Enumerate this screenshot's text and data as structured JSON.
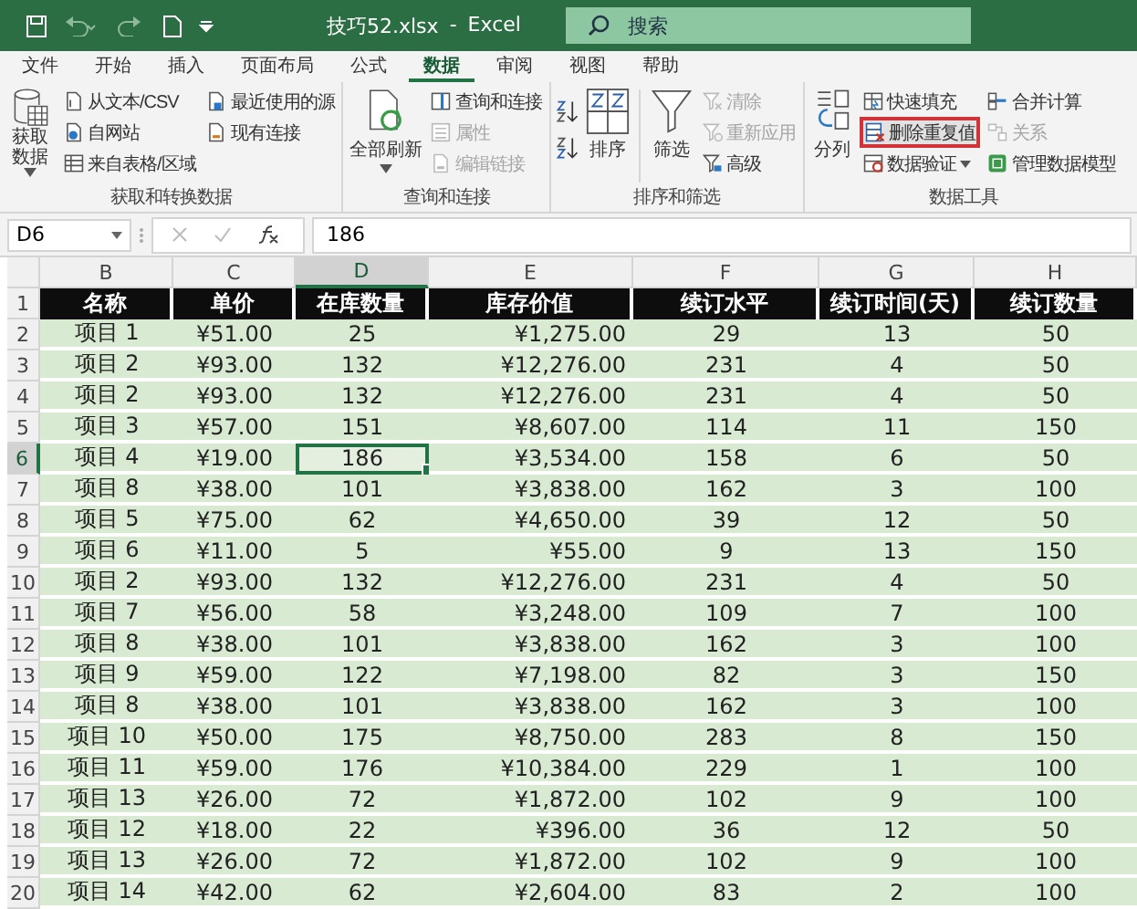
{
  "title_bar": {
    "filename": "技巧52.xlsx",
    "separator": "-",
    "app": "Excel",
    "search_placeholder": "搜索"
  },
  "menu_tabs": [
    {
      "label": "文件",
      "selected": false
    },
    {
      "label": "开始",
      "selected": false
    },
    {
      "label": "插入",
      "selected": false
    },
    {
      "label": "页面布局",
      "selected": false
    },
    {
      "label": "公式",
      "selected": false
    },
    {
      "label": "数据",
      "selected": true
    },
    {
      "label": "审阅",
      "selected": false
    },
    {
      "label": "视图",
      "selected": false
    },
    {
      "label": "帮助",
      "selected": false
    }
  ],
  "ribbon": {
    "groups": [
      {
        "label": "获取和转换数据",
        "controls": [
          {
            "kind": "large",
            "label": "获取数据",
            "dropdown": true,
            "disabled": false,
            "highlighted": false
          },
          {
            "kind": "small",
            "label": "从文本/CSV",
            "dropdown": false,
            "disabled": false,
            "highlighted": false
          },
          {
            "kind": "small",
            "label": "自网站",
            "dropdown": false,
            "disabled": false,
            "highlighted": false
          },
          {
            "kind": "small",
            "label": "来自表格/区域",
            "dropdown": false,
            "disabled": false,
            "highlighted": false
          },
          {
            "kind": "small",
            "label": "最近使用的源",
            "dropdown": false,
            "disabled": false,
            "highlighted": false
          },
          {
            "kind": "small",
            "label": "现有连接",
            "dropdown": false,
            "disabled": false,
            "highlighted": false
          }
        ]
      },
      {
        "label": "查询和连接",
        "controls": [
          {
            "kind": "large",
            "label": "全部刷新",
            "dropdown": true,
            "disabled": false,
            "highlighted": false
          },
          {
            "kind": "small",
            "label": "查询和连接",
            "dropdown": false,
            "disabled": false,
            "highlighted": false
          },
          {
            "kind": "small",
            "label": "属性",
            "dropdown": false,
            "disabled": true,
            "highlighted": false
          },
          {
            "kind": "small",
            "label": "编辑链接",
            "dropdown": false,
            "disabled": true,
            "highlighted": false
          }
        ]
      },
      {
        "label": "排序和筛选",
        "controls": [
          {
            "kind": "sort_pair"
          },
          {
            "kind": "large",
            "label": "排序",
            "dropdown": false,
            "disabled": false,
            "highlighted": false
          },
          {
            "kind": "large",
            "label": "筛选",
            "dropdown": false,
            "disabled": false,
            "highlighted": false
          },
          {
            "kind": "small",
            "label": "清除",
            "dropdown": false,
            "disabled": true,
            "highlighted": false
          },
          {
            "kind": "small",
            "label": "重新应用",
            "dropdown": false,
            "disabled": true,
            "highlighted": false
          },
          {
            "kind": "small",
            "label": "高级",
            "dropdown": false,
            "disabled": false,
            "highlighted": false
          }
        ]
      },
      {
        "label": "数据工具",
        "controls": [
          {
            "kind": "large",
            "label": "分列",
            "dropdown": false,
            "disabled": false,
            "highlighted": false
          },
          {
            "kind": "small",
            "label": "快速填充",
            "dropdown": false,
            "disabled": false,
            "highlighted": false
          },
          {
            "kind": "small",
            "label": "删除重复值",
            "dropdown": false,
            "disabled": false,
            "highlighted": true
          },
          {
            "kind": "small",
            "label": "数据验证",
            "dropdown": true,
            "disabled": false,
            "highlighted": false
          },
          {
            "kind": "small",
            "label": "合并计算",
            "dropdown": false,
            "disabled": false,
            "highlighted": false
          },
          {
            "kind": "small",
            "label": "关系",
            "dropdown": false,
            "disabled": true,
            "highlighted": false
          },
          {
            "kind": "small",
            "label": "管理数据模型",
            "dropdown": false,
            "disabled": false,
            "highlighted": false
          }
        ]
      }
    ]
  },
  "formula_bar": {
    "name_box": "D6",
    "formula": "186"
  },
  "sheet": {
    "columns": [
      {
        "label": "B",
        "selected": false
      },
      {
        "label": "C",
        "selected": false
      },
      {
        "label": "D",
        "selected": true
      },
      {
        "label": "E",
        "selected": false
      },
      {
        "label": "F",
        "selected": false
      },
      {
        "label": "G",
        "selected": false
      },
      {
        "label": "H",
        "selected": false
      }
    ],
    "rows": [
      {
        "number": "1",
        "kind": "header",
        "selected": false,
        "cells": [
          {
            "text": "名称",
            "active": false
          },
          {
            "text": "单价",
            "active": false
          },
          {
            "text": "在库数量",
            "active": false
          },
          {
            "text": "库存价值",
            "active": false
          },
          {
            "text": "续订水平",
            "active": false
          },
          {
            "text": "续订时间(天)",
            "active": false
          },
          {
            "text": "续订数量",
            "active": false
          }
        ]
      },
      {
        "number": "2",
        "kind": "data",
        "selected": false,
        "cells": [
          {
            "text": "项目 1",
            "active": false
          },
          {
            "text": "¥51.00",
            "active": false
          },
          {
            "text": "25",
            "active": false
          },
          {
            "text": "¥1,275.00",
            "active": false
          },
          {
            "text": "29",
            "active": false
          },
          {
            "text": "13",
            "active": false
          },
          {
            "text": "50",
            "active": false
          }
        ]
      },
      {
        "number": "3",
        "kind": "data",
        "selected": false,
        "cells": [
          {
            "text": "项目 2",
            "active": false
          },
          {
            "text": "¥93.00",
            "active": false
          },
          {
            "text": "132",
            "active": false
          },
          {
            "text": "¥12,276.00",
            "active": false
          },
          {
            "text": "231",
            "active": false
          },
          {
            "text": "4",
            "active": false
          },
          {
            "text": "50",
            "active": false
          }
        ]
      },
      {
        "number": "4",
        "kind": "data",
        "selected": false,
        "cells": [
          {
            "text": "项目 2",
            "active": false
          },
          {
            "text": "¥93.00",
            "active": false
          },
          {
            "text": "132",
            "active": false
          },
          {
            "text": "¥12,276.00",
            "active": false
          },
          {
            "text": "231",
            "active": false
          },
          {
            "text": "4",
            "active": false
          },
          {
            "text": "50",
            "active": false
          }
        ]
      },
      {
        "number": "5",
        "kind": "data",
        "selected": false,
        "cells": [
          {
            "text": "项目 3",
            "active": false
          },
          {
            "text": "¥57.00",
            "active": false
          },
          {
            "text": "151",
            "active": false
          },
          {
            "text": "¥8,607.00",
            "active": false
          },
          {
            "text": "114",
            "active": false
          },
          {
            "text": "11",
            "active": false
          },
          {
            "text": "150",
            "active": false
          }
        ]
      },
      {
        "number": "6",
        "kind": "data",
        "selected": true,
        "cells": [
          {
            "text": "项目 4",
            "active": false
          },
          {
            "text": "¥19.00",
            "active": false
          },
          {
            "text": "186",
            "active": true
          },
          {
            "text": "¥3,534.00",
            "active": false
          },
          {
            "text": "158",
            "active": false
          },
          {
            "text": "6",
            "active": false
          },
          {
            "text": "50",
            "active": false
          }
        ]
      },
      {
        "number": "7",
        "kind": "data",
        "selected": false,
        "cells": [
          {
            "text": "项目 8",
            "active": false
          },
          {
            "text": "¥38.00",
            "active": false
          },
          {
            "text": "101",
            "active": false
          },
          {
            "text": "¥3,838.00",
            "active": false
          },
          {
            "text": "162",
            "active": false
          },
          {
            "text": "3",
            "active": false
          },
          {
            "text": "100",
            "active": false
          }
        ]
      },
      {
        "number": "8",
        "kind": "data",
        "selected": false,
        "cells": [
          {
            "text": "项目 5",
            "active": false
          },
          {
            "text": "¥75.00",
            "active": false
          },
          {
            "text": "62",
            "active": false
          },
          {
            "text": "¥4,650.00",
            "active": false
          },
          {
            "text": "39",
            "active": false
          },
          {
            "text": "12",
            "active": false
          },
          {
            "text": "50",
            "active": false
          }
        ]
      },
      {
        "number": "9",
        "kind": "data",
        "selected": false,
        "cells": [
          {
            "text": "项目 6",
            "active": false
          },
          {
            "text": "¥11.00",
            "active": false
          },
          {
            "text": "5",
            "active": false
          },
          {
            "text": "¥55.00",
            "active": false
          },
          {
            "text": "9",
            "active": false
          },
          {
            "text": "13",
            "active": false
          },
          {
            "text": "150",
            "active": false
          }
        ]
      },
      {
        "number": "10",
        "kind": "data",
        "selected": false,
        "cells": [
          {
            "text": "项目 2",
            "active": false
          },
          {
            "text": "¥93.00",
            "active": false
          },
          {
            "text": "132",
            "active": false
          },
          {
            "text": "¥12,276.00",
            "active": false
          },
          {
            "text": "231",
            "active": false
          },
          {
            "text": "4",
            "active": false
          },
          {
            "text": "50",
            "active": false
          }
        ]
      },
      {
        "number": "11",
        "kind": "data",
        "selected": false,
        "cells": [
          {
            "text": "项目 7",
            "active": false
          },
          {
            "text": "¥56.00",
            "active": false
          },
          {
            "text": "58",
            "active": false
          },
          {
            "text": "¥3,248.00",
            "active": false
          },
          {
            "text": "109",
            "active": false
          },
          {
            "text": "7",
            "active": false
          },
          {
            "text": "100",
            "active": false
          }
        ]
      },
      {
        "number": "12",
        "kind": "data",
        "selected": false,
        "cells": [
          {
            "text": "项目 8",
            "active": false
          },
          {
            "text": "¥38.00",
            "active": false
          },
          {
            "text": "101",
            "active": false
          },
          {
            "text": "¥3,838.00",
            "active": false
          },
          {
            "text": "162",
            "active": false
          },
          {
            "text": "3",
            "active": false
          },
          {
            "text": "100",
            "active": false
          }
        ]
      },
      {
        "number": "13",
        "kind": "data",
        "selected": false,
        "cells": [
          {
            "text": "项目 9",
            "active": false
          },
          {
            "text": "¥59.00",
            "active": false
          },
          {
            "text": "122",
            "active": false
          },
          {
            "text": "¥7,198.00",
            "active": false
          },
          {
            "text": "82",
            "active": false
          },
          {
            "text": "3",
            "active": false
          },
          {
            "text": "150",
            "active": false
          }
        ]
      },
      {
        "number": "14",
        "kind": "data",
        "selected": false,
        "cells": [
          {
            "text": "项目 8",
            "active": false
          },
          {
            "text": "¥38.00",
            "active": false
          },
          {
            "text": "101",
            "active": false
          },
          {
            "text": "¥3,838.00",
            "active": false
          },
          {
            "text": "162",
            "active": false
          },
          {
            "text": "3",
            "active": false
          },
          {
            "text": "100",
            "active": false
          }
        ]
      },
      {
        "number": "15",
        "kind": "data",
        "selected": false,
        "cells": [
          {
            "text": "项目 10",
            "active": false
          },
          {
            "text": "¥50.00",
            "active": false
          },
          {
            "text": "175",
            "active": false
          },
          {
            "text": "¥8,750.00",
            "active": false
          },
          {
            "text": "283",
            "active": false
          },
          {
            "text": "8",
            "active": false
          },
          {
            "text": "150",
            "active": false
          }
        ]
      },
      {
        "number": "16",
        "kind": "data",
        "selected": false,
        "cells": [
          {
            "text": "项目 11",
            "active": false
          },
          {
            "text": "¥59.00",
            "active": false
          },
          {
            "text": "176",
            "active": false
          },
          {
            "text": "¥10,384.00",
            "active": false
          },
          {
            "text": "229",
            "active": false
          },
          {
            "text": "1",
            "active": false
          },
          {
            "text": "100",
            "active": false
          }
        ]
      },
      {
        "number": "17",
        "kind": "data",
        "selected": false,
        "cells": [
          {
            "text": "项目 13",
            "active": false
          },
          {
            "text": "¥26.00",
            "active": false
          },
          {
            "text": "72",
            "active": false
          },
          {
            "text": "¥1,872.00",
            "active": false
          },
          {
            "text": "102",
            "active": false
          },
          {
            "text": "9",
            "active": false
          },
          {
            "text": "100",
            "active": false
          }
        ]
      },
      {
        "number": "18",
        "kind": "data",
        "selected": false,
        "cells": [
          {
            "text": "项目 12",
            "active": false
          },
          {
            "text": "¥18.00",
            "active": false
          },
          {
            "text": "22",
            "active": false
          },
          {
            "text": "¥396.00",
            "active": false
          },
          {
            "text": "36",
            "active": false
          },
          {
            "text": "12",
            "active": false
          },
          {
            "text": "50",
            "active": false
          }
        ]
      },
      {
        "number": "19",
        "kind": "data",
        "selected": false,
        "cells": [
          {
            "text": "项目 13",
            "active": false
          },
          {
            "text": "¥26.00",
            "active": false
          },
          {
            "text": "72",
            "active": false
          },
          {
            "text": "¥1,872.00",
            "active": false
          },
          {
            "text": "102",
            "active": false
          },
          {
            "text": "9",
            "active": false
          },
          {
            "text": "100",
            "active": false
          }
        ]
      },
      {
        "number": "20",
        "kind": "data",
        "selected": false,
        "cells": [
          {
            "text": "项目 14",
            "active": false
          },
          {
            "text": "¥42.00",
            "active": false
          },
          {
            "text": "62",
            "active": false
          },
          {
            "text": "¥2,604.00",
            "active": false
          },
          {
            "text": "83",
            "active": false
          },
          {
            "text": "2",
            "active": false
          },
          {
            "text": "100",
            "active": false
          }
        ]
      }
    ]
  }
}
